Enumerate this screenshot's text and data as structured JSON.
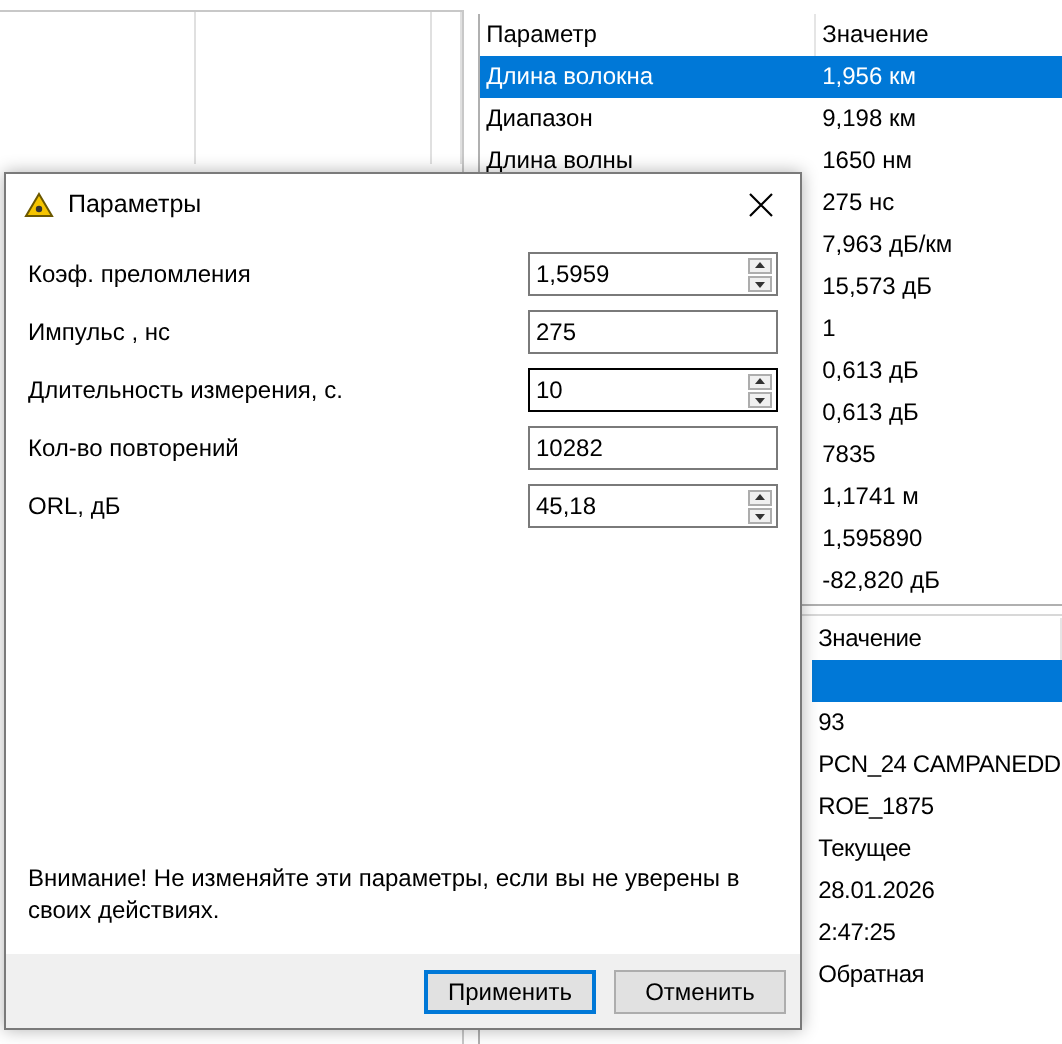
{
  "parameters_table": {
    "columns": [
      "Параметр",
      "Значение"
    ],
    "rows": [
      {
        "name": "Длина волокна",
        "value": "1,956 км",
        "selected": true
      },
      {
        "name": "Диапазон",
        "value": "9,198 км",
        "selected": false
      },
      {
        "name": "Длина волны",
        "value": "1650 нм",
        "selected": false
      },
      {
        "value": "275 нс",
        "selected": false
      },
      {
        "value": "7,963 дБ/км",
        "selected": false
      },
      {
        "value": "15,573 дБ",
        "selected": false
      },
      {
        "value": "1",
        "selected": false
      },
      {
        "value": "0,613 дБ",
        "selected": false
      },
      {
        "value": "0,613 дБ",
        "selected": false
      },
      {
        "value": "7835",
        "selected": false
      },
      {
        "value": "1,1741 м",
        "selected": false
      },
      {
        "value": "1,595890",
        "selected": false
      },
      {
        "value": "-82,820 дБ",
        "selected": false
      }
    ]
  },
  "info_table": {
    "columns": [
      "Значение"
    ],
    "rows": [
      {
        "selected": true
      },
      {
        "value": "93",
        "selected": false
      },
      {
        "value": "PCN_24 CAMPANEDD",
        "selected": false
      },
      {
        "value": "ROE_1875",
        "selected": false
      },
      {
        "value": "Текущее",
        "selected": false
      },
      {
        "value": "28.01.2026",
        "selected": false
      },
      {
        "value": "2:47:25",
        "selected": false
      },
      {
        "value": "Обратная",
        "selected": false
      },
      {
        "selected": false
      }
    ]
  },
  "dialog": {
    "title": "Параметры",
    "fields": [
      {
        "label": "Коэф. преломления",
        "value": "1,5959",
        "kind": "spin",
        "focused": false
      },
      {
        "label": "Импульс , нс",
        "value": "275",
        "kind": "text",
        "focused": false
      },
      {
        "label": "Длительность измерения, с.",
        "value": "10",
        "kind": "spin",
        "focused": true
      },
      {
        "label": "Кол-во повторений",
        "value": "10282",
        "kind": "text",
        "focused": false
      },
      {
        "label": "ORL, дБ",
        "value": "45,18",
        "kind": "spin",
        "focused": false
      }
    ],
    "warning": "Внимание! Не изменяйте эти параметры, если вы не уверены в своих действиях.",
    "buttons": [
      {
        "label": "Применить",
        "default": true
      },
      {
        "label": "Отменить",
        "default": false
      }
    ]
  }
}
